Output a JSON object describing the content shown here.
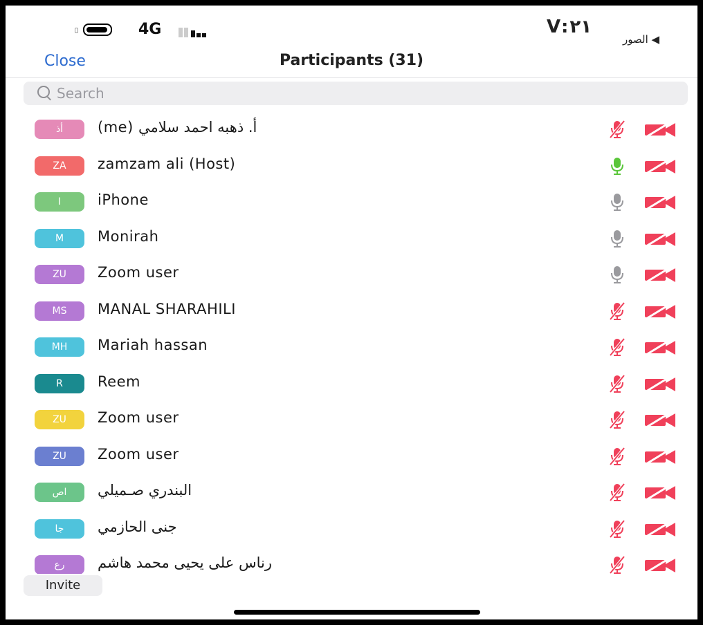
{
  "status_bar": {
    "network": "4G",
    "time": "V:٢١",
    "back_app": "◀ الصور"
  },
  "header": {
    "close_label": "Close",
    "title": "Participants (31)"
  },
  "search": {
    "placeholder": "Search"
  },
  "participants": [
    {
      "initials": "أذ",
      "name": "(me) أ. ذهبه احمد سلامي",
      "color": "#e58ab7",
      "mic": "muted",
      "video": "off"
    },
    {
      "initials": "ZA",
      "name": "zamzam ali (Host)",
      "color": "#f26a6a",
      "mic": "active",
      "video": "off"
    },
    {
      "initials": "I",
      "name": "iPhone",
      "color": "#7dc87d",
      "mic": "on",
      "video": "off"
    },
    {
      "initials": "M",
      "name": "Monirah",
      "color": "#4fc3dc",
      "mic": "on",
      "video": "off"
    },
    {
      "initials": "ZU",
      "name": "Zoom user",
      "color": "#b479d4",
      "mic": "on",
      "video": "off"
    },
    {
      "initials": "MS",
      "name": "MANAL SHARAHILI",
      "color": "#b479d4",
      "mic": "muted",
      "video": "off"
    },
    {
      "initials": "MH",
      "name": "Mariah hassan",
      "color": "#4fc3dc",
      "mic": "muted",
      "video": "off"
    },
    {
      "initials": "R",
      "name": "Reem",
      "color": "#1a8a8f",
      "mic": "muted",
      "video": "off"
    },
    {
      "initials": "ZU",
      "name": "Zoom user",
      "color": "#f2d33d",
      "mic": "muted",
      "video": "off"
    },
    {
      "initials": "ZU",
      "name": "Zoom user",
      "color": "#6b7fd0",
      "mic": "muted",
      "video": "off"
    },
    {
      "initials": "اص",
      "name": "البندري صـميلي",
      "color": "#6cc58a",
      "mic": "muted",
      "video": "off"
    },
    {
      "initials": "جا",
      "name": "جنى الحازمي",
      "color": "#4fc3dc",
      "mic": "muted",
      "video": "off"
    },
    {
      "initials": "رع",
      "name": "رناس على يحيى محمد هاشم",
      "color": "#b479d4",
      "mic": "muted",
      "video": "off"
    }
  ],
  "invite_label": "Invite",
  "colors": {
    "accent": "#2d6bcf",
    "muted_red": "#f0405a",
    "mic_active": "#5ac63a",
    "mic_on": "#9a9a9e"
  }
}
